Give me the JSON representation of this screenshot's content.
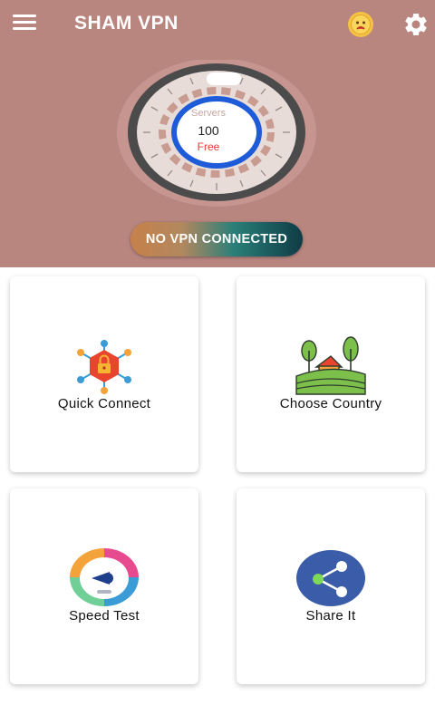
{
  "header": {
    "title": "SHAM VPN",
    "colors": {
      "background": "#b9857f",
      "accent": "#1e5bd8"
    },
    "icons": {
      "menu": "hamburger-menu-icon",
      "theme": "sun-face-icon",
      "settings": "gear-icon"
    }
  },
  "gauge": {
    "label": "Servers",
    "count": "100",
    "tier": "Free"
  },
  "status": {
    "text": "NO VPN CONNECTED"
  },
  "cards": {
    "quick_connect": {
      "label": "Quick Connect",
      "icon": "lock-network-icon"
    },
    "choose_country": {
      "label": "Choose Country",
      "icon": "farm-landscape-icon"
    },
    "speed_test": {
      "label": "Speed Test",
      "icon": "speedometer-icon"
    },
    "share_it": {
      "label": "Share It",
      "icon": "share-icon"
    }
  }
}
